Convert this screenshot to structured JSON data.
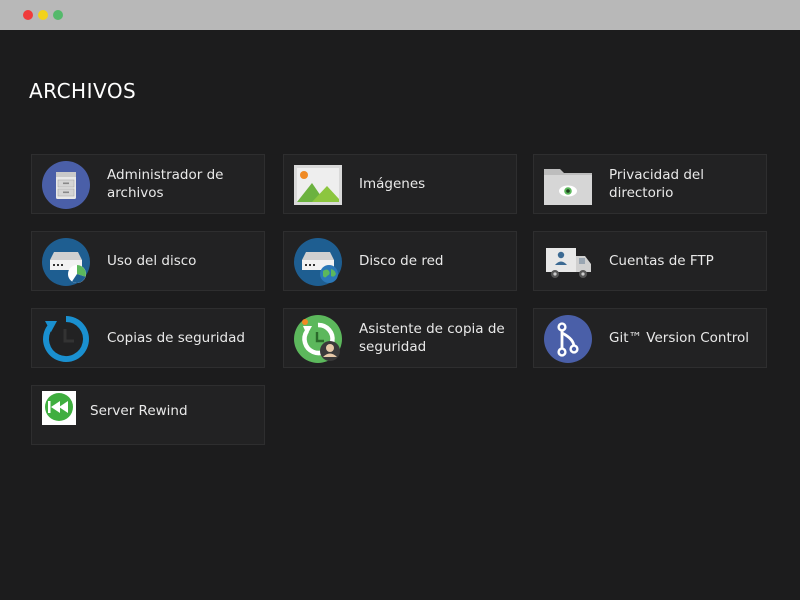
{
  "section": {
    "title": "ARCHIVOS"
  },
  "tiles": [
    {
      "label": "Administrador de archivos",
      "icon": "file-cabinet-icon"
    },
    {
      "label": "Imágenes",
      "icon": "image-icon"
    },
    {
      "label": "Privacidad del directorio",
      "icon": "folder-eye-icon"
    },
    {
      "label": "Uso del disco",
      "icon": "disk-usage-icon"
    },
    {
      "label": "Disco de red",
      "icon": "network-disk-icon"
    },
    {
      "label": "Cuentas de FTP",
      "icon": "ftp-truck-icon"
    },
    {
      "label": "Copias de seguridad",
      "icon": "backup-clock-icon"
    },
    {
      "label": "Asistente de copia de seguridad",
      "icon": "backup-wizard-icon"
    },
    {
      "label": "Git™ Version Control",
      "icon": "git-branch-icon"
    },
    {
      "label": "Server Rewind",
      "icon": "rewind-icon"
    }
  ],
  "colors": {
    "background": "#1c1c1d",
    "tile": "#222223",
    "text": "#e9e9e9",
    "accent_blue": "#4a5fa8",
    "accent_green": "#5cb85c"
  }
}
